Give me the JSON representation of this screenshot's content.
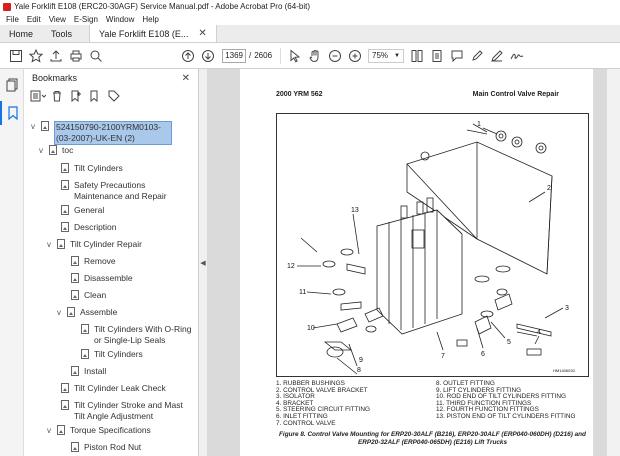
{
  "window": {
    "title": "Yale Forklift E108 (ERC20-30AGF) Service Manual.pdf - Adobe Acrobat Pro (64-bit)"
  },
  "menu": [
    "File",
    "Edit",
    "View",
    "E-Sign",
    "Window",
    "Help"
  ],
  "tabs": {
    "home": "Home",
    "tools": "Tools",
    "doc": "Yale Forklift E108 (E..."
  },
  "toolbar": {
    "page_current": "1369",
    "page_sep": "/",
    "page_total": "2606",
    "zoom": "75%"
  },
  "bookmarks_panel": {
    "title": "Bookmarks",
    "items": [
      {
        "label": "524150790-2100YRM0103-(03-2007)-UK-EN (2)",
        "twisty": "v"
      },
      {
        "label": "toc",
        "twisty": "v"
      },
      {
        "label": "Tilt Cylinders",
        "twisty": ""
      },
      {
        "label": "Safety Precautions Maintenance and Repair",
        "twisty": ""
      },
      {
        "label": "General",
        "twisty": ""
      },
      {
        "label": "Description",
        "twisty": ""
      },
      {
        "label": "Tilt Cylinder Repair",
        "twisty": "v"
      },
      {
        "label": "Remove",
        "twisty": ""
      },
      {
        "label": "Disassemble",
        "twisty": ""
      },
      {
        "label": "Clean",
        "twisty": ""
      },
      {
        "label": "Assemble",
        "twisty": "v"
      },
      {
        "label": "Tilt Cylinders With O-Ring or Single-Lip Seals",
        "twisty": ""
      },
      {
        "label": "Tilt Cylinders",
        "twisty": ""
      },
      {
        "label": "Install",
        "twisty": ""
      },
      {
        "label": "Tilt Cylinder Leak Check",
        "twisty": ""
      },
      {
        "label": "Tilt Cylinder Stroke and Mast Tilt Angle Adjustment",
        "twisty": ""
      },
      {
        "label": "Torque Specifications",
        "twisty": "v"
      },
      {
        "label": "Piston Rod Nut",
        "twisty": ""
      }
    ]
  },
  "document": {
    "header_left": "2000 YRM 562",
    "header_right": "Main Control Valve Repair",
    "figure_code": "HM1406030",
    "callouts": [
      "1",
      "2",
      "3",
      "4",
      "5",
      "6",
      "7",
      "8",
      "9",
      "10",
      "11",
      "12",
      "13"
    ],
    "legend_left": [
      "1.  RUBBER BUSHINGS",
      "2.  CONTROL VALVE BRACKET",
      "3.  ISOLATOR",
      "4.  BRACKET",
      "5.  STEERING CIRCUIT FITTING",
      "6.  INLET FITTING",
      "7.  CONTROL VALVE"
    ],
    "legend_right": [
      "8.  OUTLET FITTING",
      "9.  LIFT CYLINDERS FITTING",
      "10. ROD END OF TILT CYLINDERS FITTING",
      "11. THIRD FUNCTION FITTINGS",
      "12. FOURTH FUNCTION FITTINGS",
      "13. PISTON END OF TILT CYLINDERS FITTING"
    ],
    "caption": "Figure 8.  Control Valve Mounting for ERP20-30ALF (B216), ERP20-30ALF (ERP040-060DH) (D216) and ERP20-32ALF (ERP040-065DH) (E216) Lift Trucks"
  }
}
